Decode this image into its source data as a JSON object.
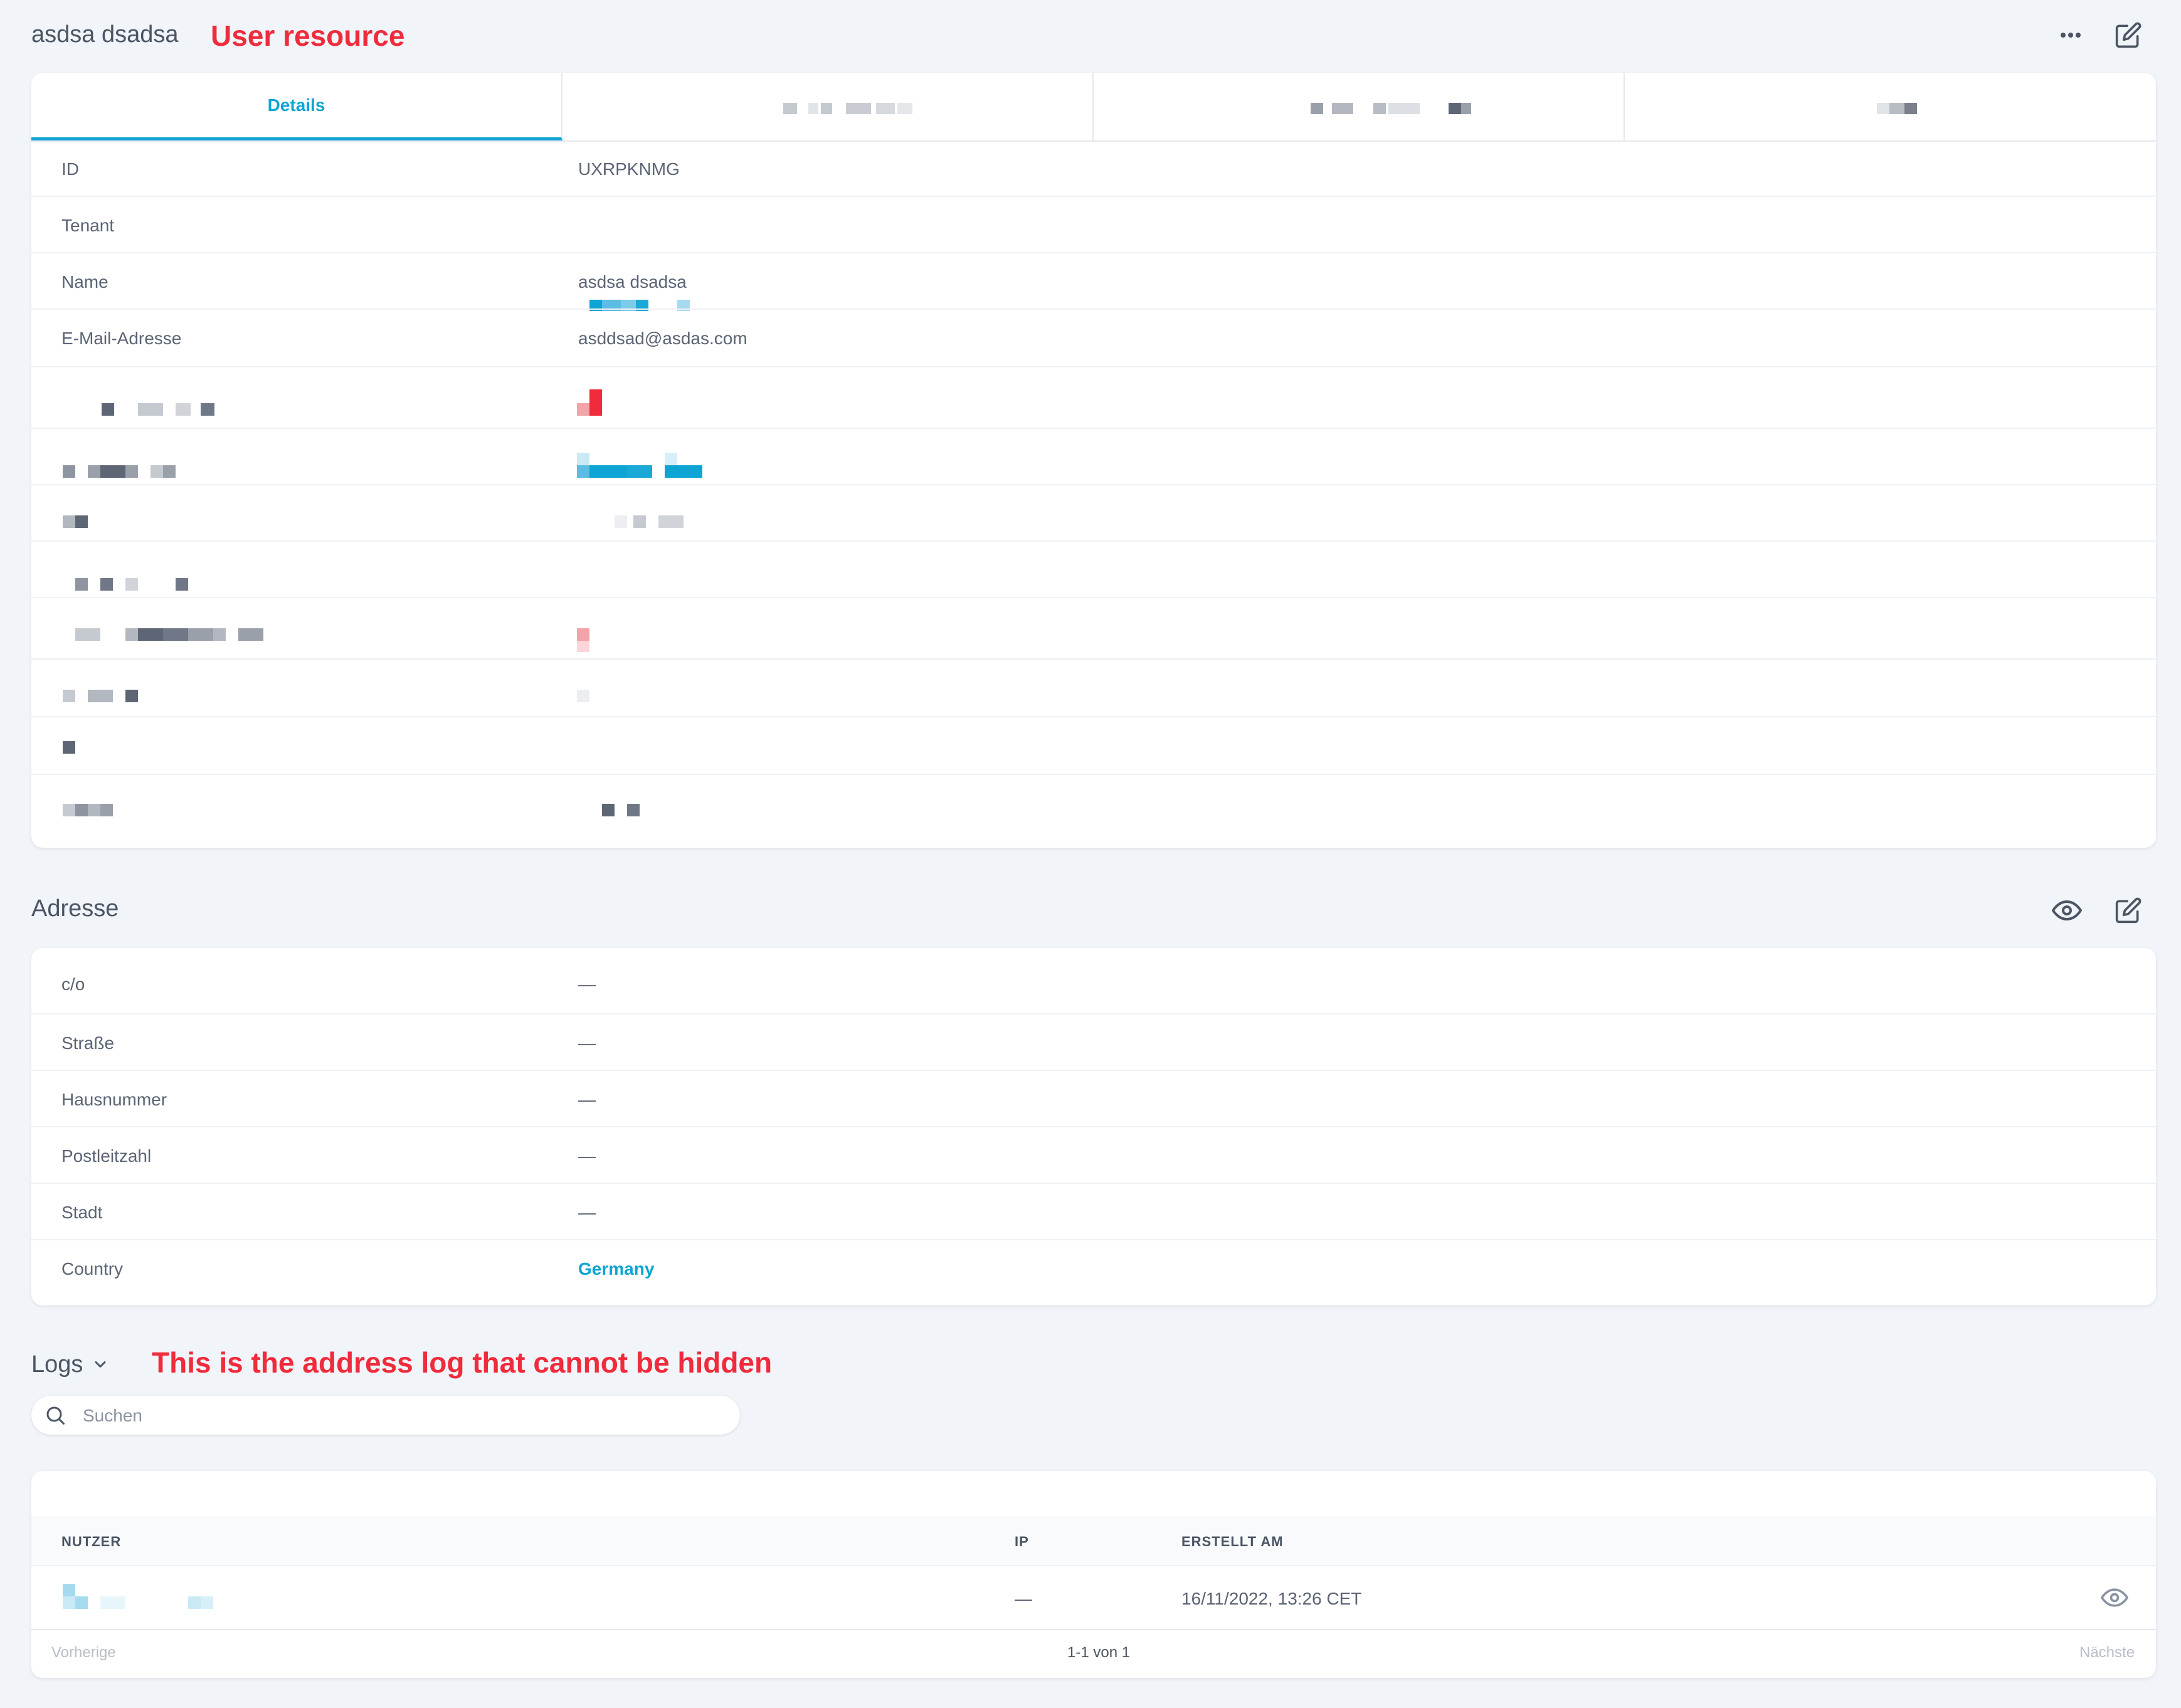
{
  "header": {
    "title": "asdsa dsadsa",
    "annotation": "User resource"
  },
  "tabs": [
    {
      "label": "Details",
      "active": true
    },
    {
      "label": "",
      "active": false
    },
    {
      "label": "",
      "active": false
    },
    {
      "label": "",
      "active": false
    }
  ],
  "details": {
    "rows": [
      {
        "label": "ID",
        "value": "UXRPKNMG"
      },
      {
        "label": "Tenant",
        "value": ""
      },
      {
        "label": "Name",
        "value": "asdsa dsadsa"
      },
      {
        "label": "E-Mail-Adresse",
        "value": "asddsad@asdas.com"
      }
    ]
  },
  "address": {
    "title": "Adresse",
    "rows": [
      {
        "label": "c/o",
        "value": "—"
      },
      {
        "label": "Straße",
        "value": "—"
      },
      {
        "label": "Hausnummer",
        "value": "—"
      },
      {
        "label": "Postleitzahl",
        "value": "—"
      },
      {
        "label": "Stadt",
        "value": "—"
      },
      {
        "label": "Country",
        "value": "Germany"
      }
    ]
  },
  "logs": {
    "title": "Logs",
    "annotation": "This is the address log that cannot be hidden",
    "search_placeholder": "Suchen",
    "columns": {
      "user": "NUTZER",
      "ip": "IP",
      "created": "ERSTELLT AM"
    },
    "rows": [
      {
        "user": "",
        "ip": "—",
        "created": "16/11/2022, 13:26 CET"
      }
    ],
    "pagination": {
      "prev": "Vorherige",
      "info": "1-1 von 1",
      "next": "Nächste"
    }
  },
  "colors": {
    "accent": "#0ea5d4",
    "annotation": "#ef2b3c",
    "background": "#f1f4f8"
  }
}
